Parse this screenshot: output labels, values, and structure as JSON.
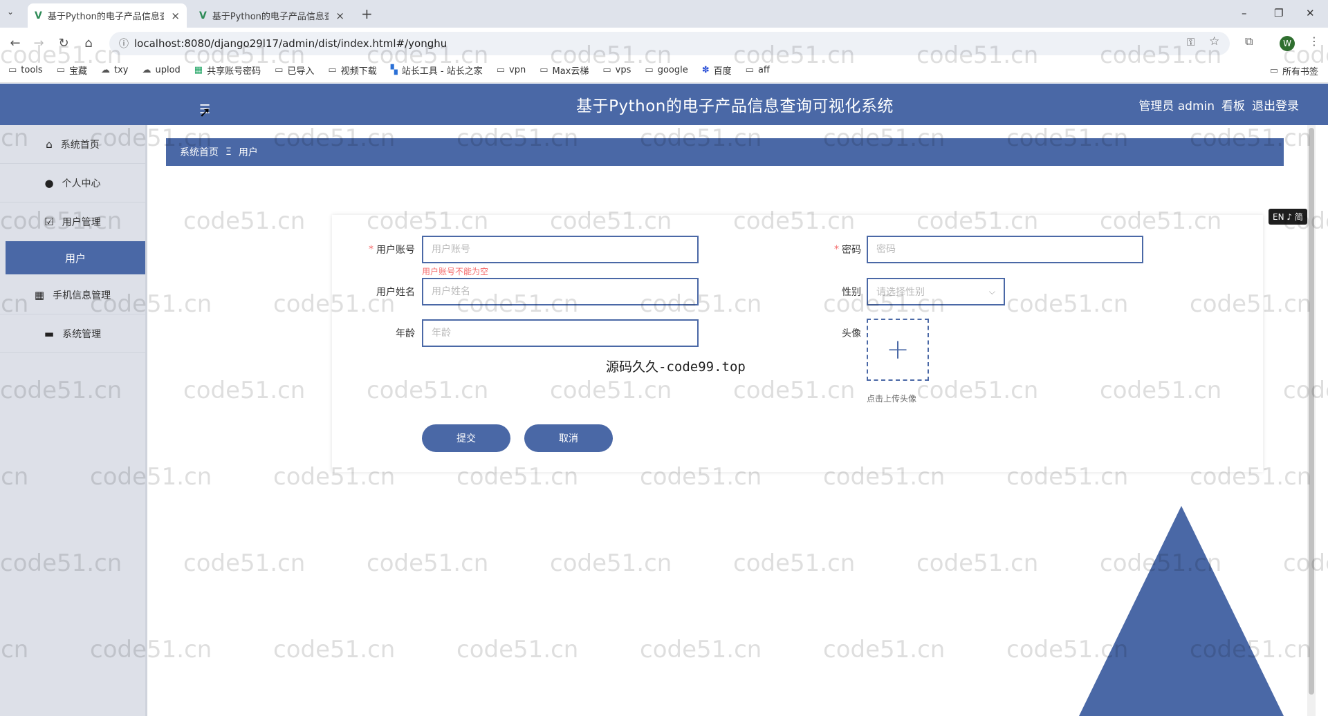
{
  "browser": {
    "tabs": [
      {
        "title": "基于Python的电子产品信息查询",
        "close": "×"
      },
      {
        "title": "基于Python的电子产品信息查询",
        "close": "×"
      }
    ],
    "new_tab": "+",
    "window_controls": {
      "minimize": "–",
      "maximize": "❐",
      "close": "✕"
    },
    "url": "localhost:8080/django29l17/admin/dist/index.html#/yonghu",
    "bookmarks": [
      "tools",
      "宝藏",
      "txy",
      "uplod",
      "共享账号密码",
      "已导入",
      "视频下载",
      "站长工具 - 站长之家",
      "vpn",
      "Max云梯",
      "vps",
      "google",
      "百度",
      "aff"
    ],
    "all_bookmarks": "所有书签",
    "profile_initial": "W"
  },
  "header": {
    "title": "基于Python的电子产品信息查询可视化系统",
    "admin_label": "管理员 admin",
    "dashboard": "看板",
    "logout": "退出登录"
  },
  "sidebar": {
    "items": [
      {
        "label": "系统首页",
        "icon": "home-icon"
      },
      {
        "label": "个人中心",
        "icon": "user-icon"
      },
      {
        "label": "用户管理",
        "icon": "checkbox-icon"
      },
      {
        "label": "手机信息管理",
        "icon": "grid-icon"
      },
      {
        "label": "系统管理",
        "icon": "system-icon"
      }
    ],
    "sub_item": "用户"
  },
  "breadcrumb": {
    "home": "系统首页",
    "sep": "Ξ",
    "current": "用户"
  },
  "form": {
    "username": {
      "label": "用户账号",
      "placeholder": "用户账号",
      "error": "用户账号不能为空"
    },
    "password": {
      "label": "密码",
      "placeholder": "密码"
    },
    "realname": {
      "label": "用户姓名",
      "placeholder": "用户姓名"
    },
    "gender": {
      "label": "性别",
      "placeholder": "请选择性别"
    },
    "age": {
      "label": "年龄",
      "placeholder": "年龄"
    },
    "avatar": {
      "label": "头像",
      "tip": "点击上传头像"
    },
    "submit": "提交",
    "cancel": "取消"
  },
  "overlay_note": "源码久久-code99.top",
  "lang_badge": "EN ♪ 简",
  "watermark": "code51.cn",
  "colors": {
    "primary": "#4a68a6",
    "sidebar_bg": "#dde0e8",
    "error": "#f56c6c"
  }
}
